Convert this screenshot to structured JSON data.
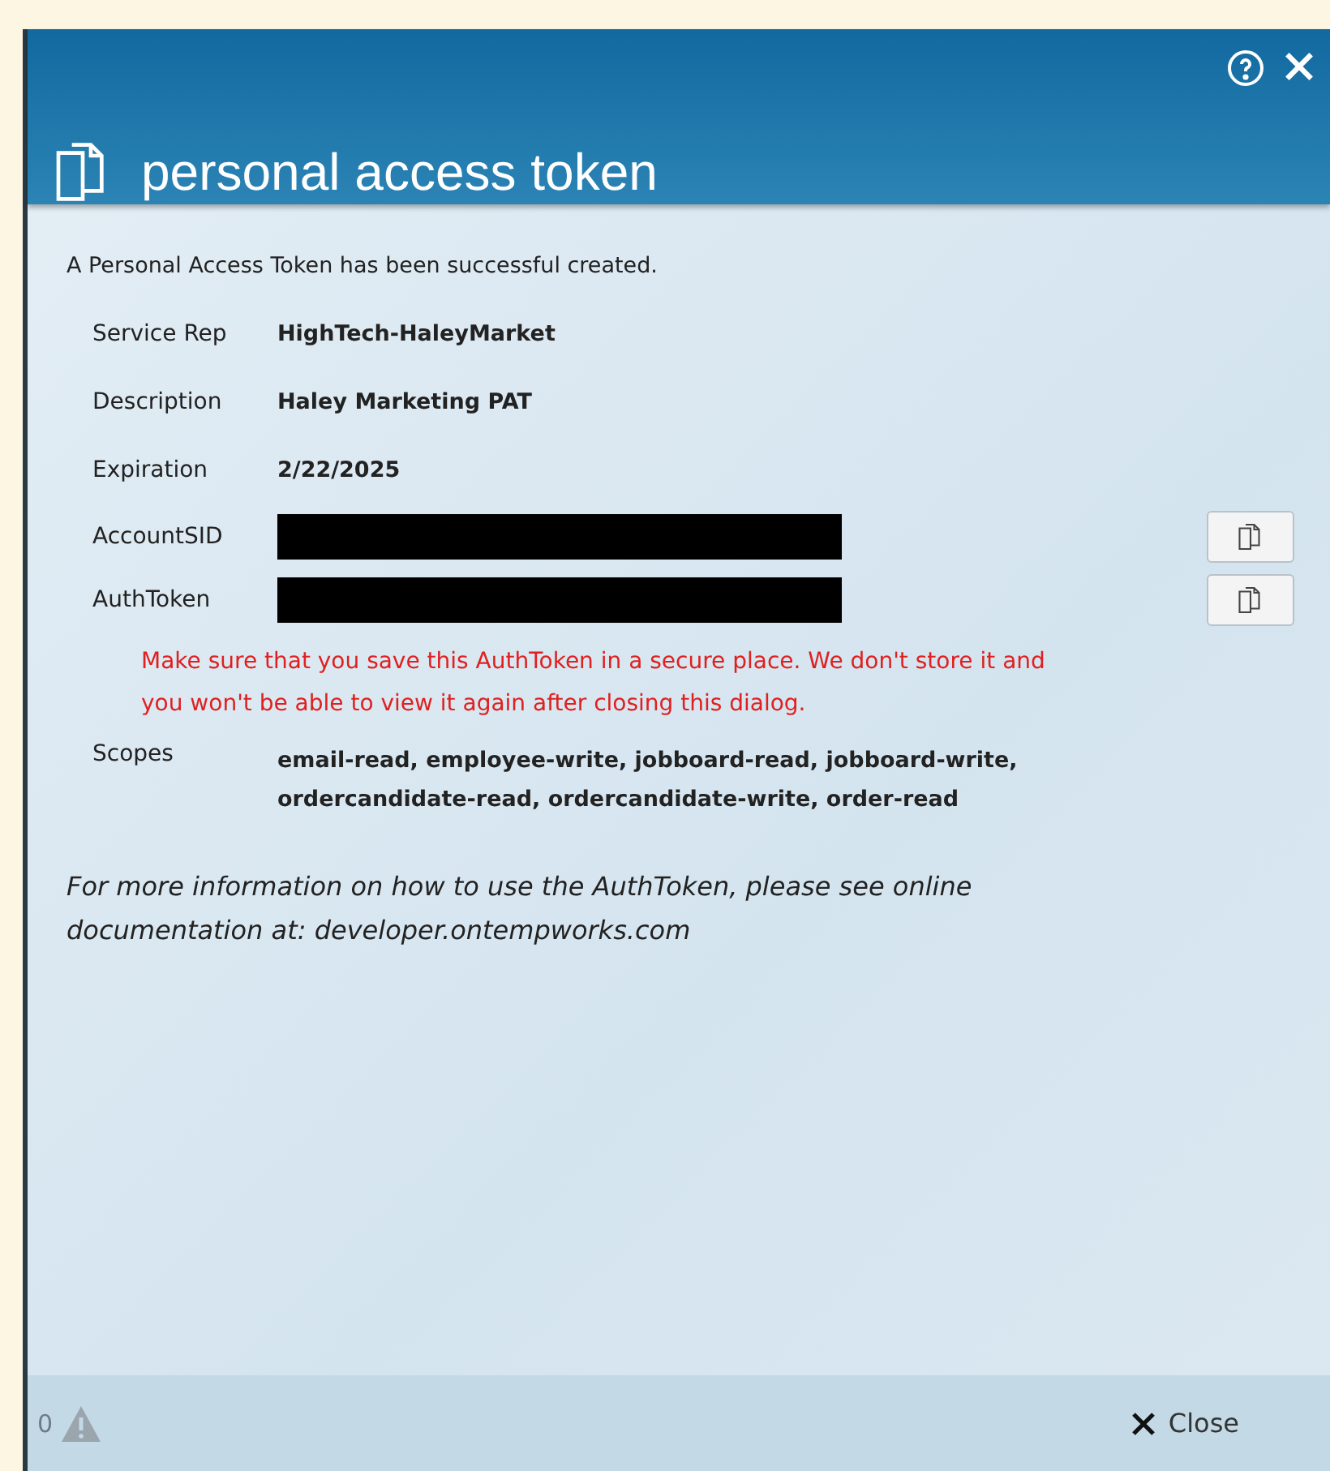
{
  "dialog": {
    "title": "personal access token",
    "intro": "A Personal Access Token has been successful created.",
    "fields": [
      {
        "kind": "text",
        "label": "Service Rep",
        "value": "HighTech-HaleyMarket"
      },
      {
        "kind": "text",
        "label": "Description",
        "value": "Haley Marketing PAT"
      },
      {
        "kind": "text",
        "label": "Expiration",
        "value": "2/22/2025"
      },
      {
        "kind": "redacted",
        "label": "AccountSID"
      },
      {
        "kind": "redacted",
        "label": "AuthToken"
      }
    ],
    "warning": "Make sure that you save this AuthToken in a secure place. We don't store it and you won't be able to view it again after closing this dialog.",
    "scopes": {
      "label": "Scopes",
      "value": "email-read, employee-write, jobboard-read, jobboard-write, ordercandidate-read, ordercandidate-write, order-read"
    },
    "info": "For more information on how to use the AuthToken, please see online documentation at: developer.ontempworks.com",
    "footer": {
      "count": "0",
      "close": "Close"
    }
  }
}
